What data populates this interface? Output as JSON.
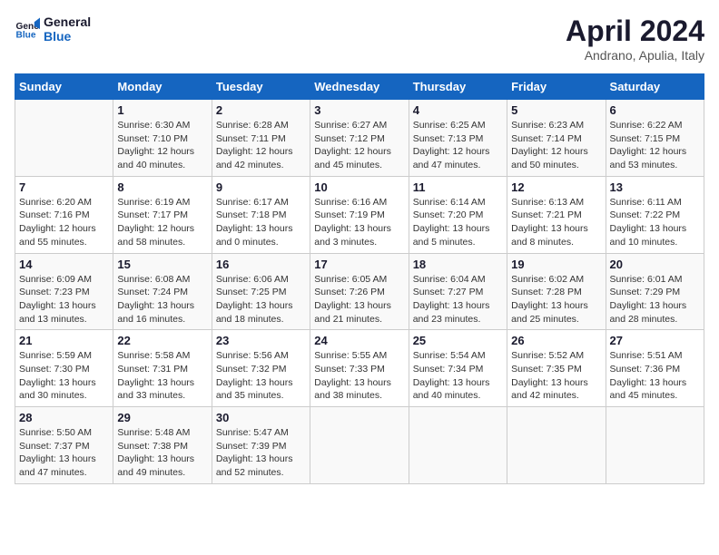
{
  "header": {
    "logo_line1": "General",
    "logo_line2": "Blue",
    "month_title": "April 2024",
    "subtitle": "Andrano, Apulia, Italy"
  },
  "days_of_week": [
    "Sunday",
    "Monday",
    "Tuesday",
    "Wednesday",
    "Thursday",
    "Friday",
    "Saturday"
  ],
  "weeks": [
    [
      {
        "day": "",
        "info": ""
      },
      {
        "day": "1",
        "info": "Sunrise: 6:30 AM\nSunset: 7:10 PM\nDaylight: 12 hours\nand 40 minutes."
      },
      {
        "day": "2",
        "info": "Sunrise: 6:28 AM\nSunset: 7:11 PM\nDaylight: 12 hours\nand 42 minutes."
      },
      {
        "day": "3",
        "info": "Sunrise: 6:27 AM\nSunset: 7:12 PM\nDaylight: 12 hours\nand 45 minutes."
      },
      {
        "day": "4",
        "info": "Sunrise: 6:25 AM\nSunset: 7:13 PM\nDaylight: 12 hours\nand 47 minutes."
      },
      {
        "day": "5",
        "info": "Sunrise: 6:23 AM\nSunset: 7:14 PM\nDaylight: 12 hours\nand 50 minutes."
      },
      {
        "day": "6",
        "info": "Sunrise: 6:22 AM\nSunset: 7:15 PM\nDaylight: 12 hours\nand 53 minutes."
      }
    ],
    [
      {
        "day": "7",
        "info": "Sunrise: 6:20 AM\nSunset: 7:16 PM\nDaylight: 12 hours\nand 55 minutes."
      },
      {
        "day": "8",
        "info": "Sunrise: 6:19 AM\nSunset: 7:17 PM\nDaylight: 12 hours\nand 58 minutes."
      },
      {
        "day": "9",
        "info": "Sunrise: 6:17 AM\nSunset: 7:18 PM\nDaylight: 13 hours\nand 0 minutes."
      },
      {
        "day": "10",
        "info": "Sunrise: 6:16 AM\nSunset: 7:19 PM\nDaylight: 13 hours\nand 3 minutes."
      },
      {
        "day": "11",
        "info": "Sunrise: 6:14 AM\nSunset: 7:20 PM\nDaylight: 13 hours\nand 5 minutes."
      },
      {
        "day": "12",
        "info": "Sunrise: 6:13 AM\nSunset: 7:21 PM\nDaylight: 13 hours\nand 8 minutes."
      },
      {
        "day": "13",
        "info": "Sunrise: 6:11 AM\nSunset: 7:22 PM\nDaylight: 13 hours\nand 10 minutes."
      }
    ],
    [
      {
        "day": "14",
        "info": "Sunrise: 6:09 AM\nSunset: 7:23 PM\nDaylight: 13 hours\nand 13 minutes."
      },
      {
        "day": "15",
        "info": "Sunrise: 6:08 AM\nSunset: 7:24 PM\nDaylight: 13 hours\nand 16 minutes."
      },
      {
        "day": "16",
        "info": "Sunrise: 6:06 AM\nSunset: 7:25 PM\nDaylight: 13 hours\nand 18 minutes."
      },
      {
        "day": "17",
        "info": "Sunrise: 6:05 AM\nSunset: 7:26 PM\nDaylight: 13 hours\nand 21 minutes."
      },
      {
        "day": "18",
        "info": "Sunrise: 6:04 AM\nSunset: 7:27 PM\nDaylight: 13 hours\nand 23 minutes."
      },
      {
        "day": "19",
        "info": "Sunrise: 6:02 AM\nSunset: 7:28 PM\nDaylight: 13 hours\nand 25 minutes."
      },
      {
        "day": "20",
        "info": "Sunrise: 6:01 AM\nSunset: 7:29 PM\nDaylight: 13 hours\nand 28 minutes."
      }
    ],
    [
      {
        "day": "21",
        "info": "Sunrise: 5:59 AM\nSunset: 7:30 PM\nDaylight: 13 hours\nand 30 minutes."
      },
      {
        "day": "22",
        "info": "Sunrise: 5:58 AM\nSunset: 7:31 PM\nDaylight: 13 hours\nand 33 minutes."
      },
      {
        "day": "23",
        "info": "Sunrise: 5:56 AM\nSunset: 7:32 PM\nDaylight: 13 hours\nand 35 minutes."
      },
      {
        "day": "24",
        "info": "Sunrise: 5:55 AM\nSunset: 7:33 PM\nDaylight: 13 hours\nand 38 minutes."
      },
      {
        "day": "25",
        "info": "Sunrise: 5:54 AM\nSunset: 7:34 PM\nDaylight: 13 hours\nand 40 minutes."
      },
      {
        "day": "26",
        "info": "Sunrise: 5:52 AM\nSunset: 7:35 PM\nDaylight: 13 hours\nand 42 minutes."
      },
      {
        "day": "27",
        "info": "Sunrise: 5:51 AM\nSunset: 7:36 PM\nDaylight: 13 hours\nand 45 minutes."
      }
    ],
    [
      {
        "day": "28",
        "info": "Sunrise: 5:50 AM\nSunset: 7:37 PM\nDaylight: 13 hours\nand 47 minutes."
      },
      {
        "day": "29",
        "info": "Sunrise: 5:48 AM\nSunset: 7:38 PM\nDaylight: 13 hours\nand 49 minutes."
      },
      {
        "day": "30",
        "info": "Sunrise: 5:47 AM\nSunset: 7:39 PM\nDaylight: 13 hours\nand 52 minutes."
      },
      {
        "day": "",
        "info": ""
      },
      {
        "day": "",
        "info": ""
      },
      {
        "day": "",
        "info": ""
      },
      {
        "day": "",
        "info": ""
      }
    ]
  ]
}
